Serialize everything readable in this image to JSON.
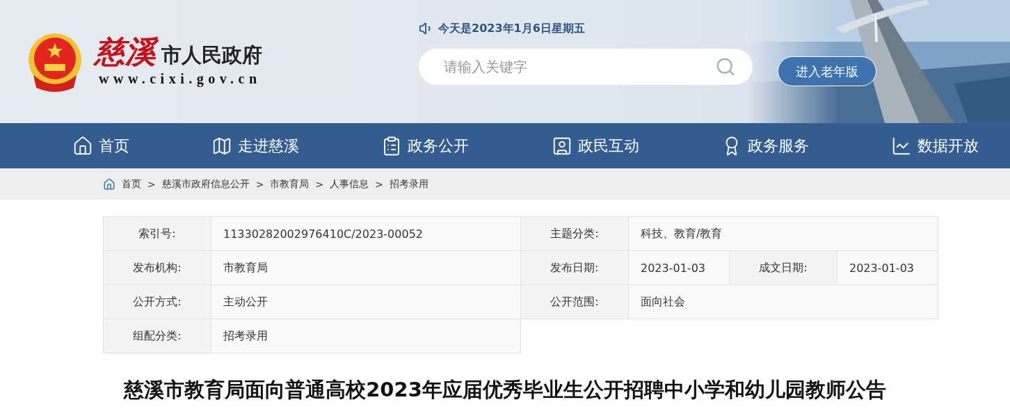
{
  "header": {
    "logo_mark": "慈溪",
    "logo_title": "市人民政府",
    "logo_url": "www.cixi.gov.cn",
    "date": "今天是2023年1月6日星期五",
    "search": {
      "placeholder": "请输入关键字"
    },
    "elder_button": "进入老年版"
  },
  "nav": [
    {
      "label": "首页"
    },
    {
      "label": "走进慈溪"
    },
    {
      "label": "政务公开"
    },
    {
      "label": "政民互动"
    },
    {
      "label": "政务服务"
    },
    {
      "label": "数据开放"
    }
  ],
  "breadcrumb": {
    "separator": ">",
    "items": [
      "首页",
      "慈溪市政府信息公开",
      "市教育局",
      "人事信息",
      "招考录用"
    ]
  },
  "info_table": {
    "left": [
      {
        "label": "索引号:",
        "value": "11330282002976410C/2023-00052"
      },
      {
        "label": "发布机构:",
        "value": "市教育局"
      },
      {
        "label": "公开方式:",
        "value": "主动公开"
      },
      {
        "label": "组配分类:",
        "value": "招考录用"
      }
    ],
    "right": [
      [
        {
          "label": "主题分类:",
          "value": "科技、教育/教育"
        }
      ],
      [
        {
          "label": "发布日期:",
          "value": "2023-01-03"
        },
        {
          "label": "成文日期:",
          "value": "2023-01-03"
        }
      ],
      [
        {
          "label": "公开范围:",
          "value": "面向社会"
        }
      ]
    ]
  },
  "article": {
    "title": "慈溪市教育局面向普通高校2023年应届优秀毕业生公开招聘中小学和幼儿园教师公告"
  }
}
